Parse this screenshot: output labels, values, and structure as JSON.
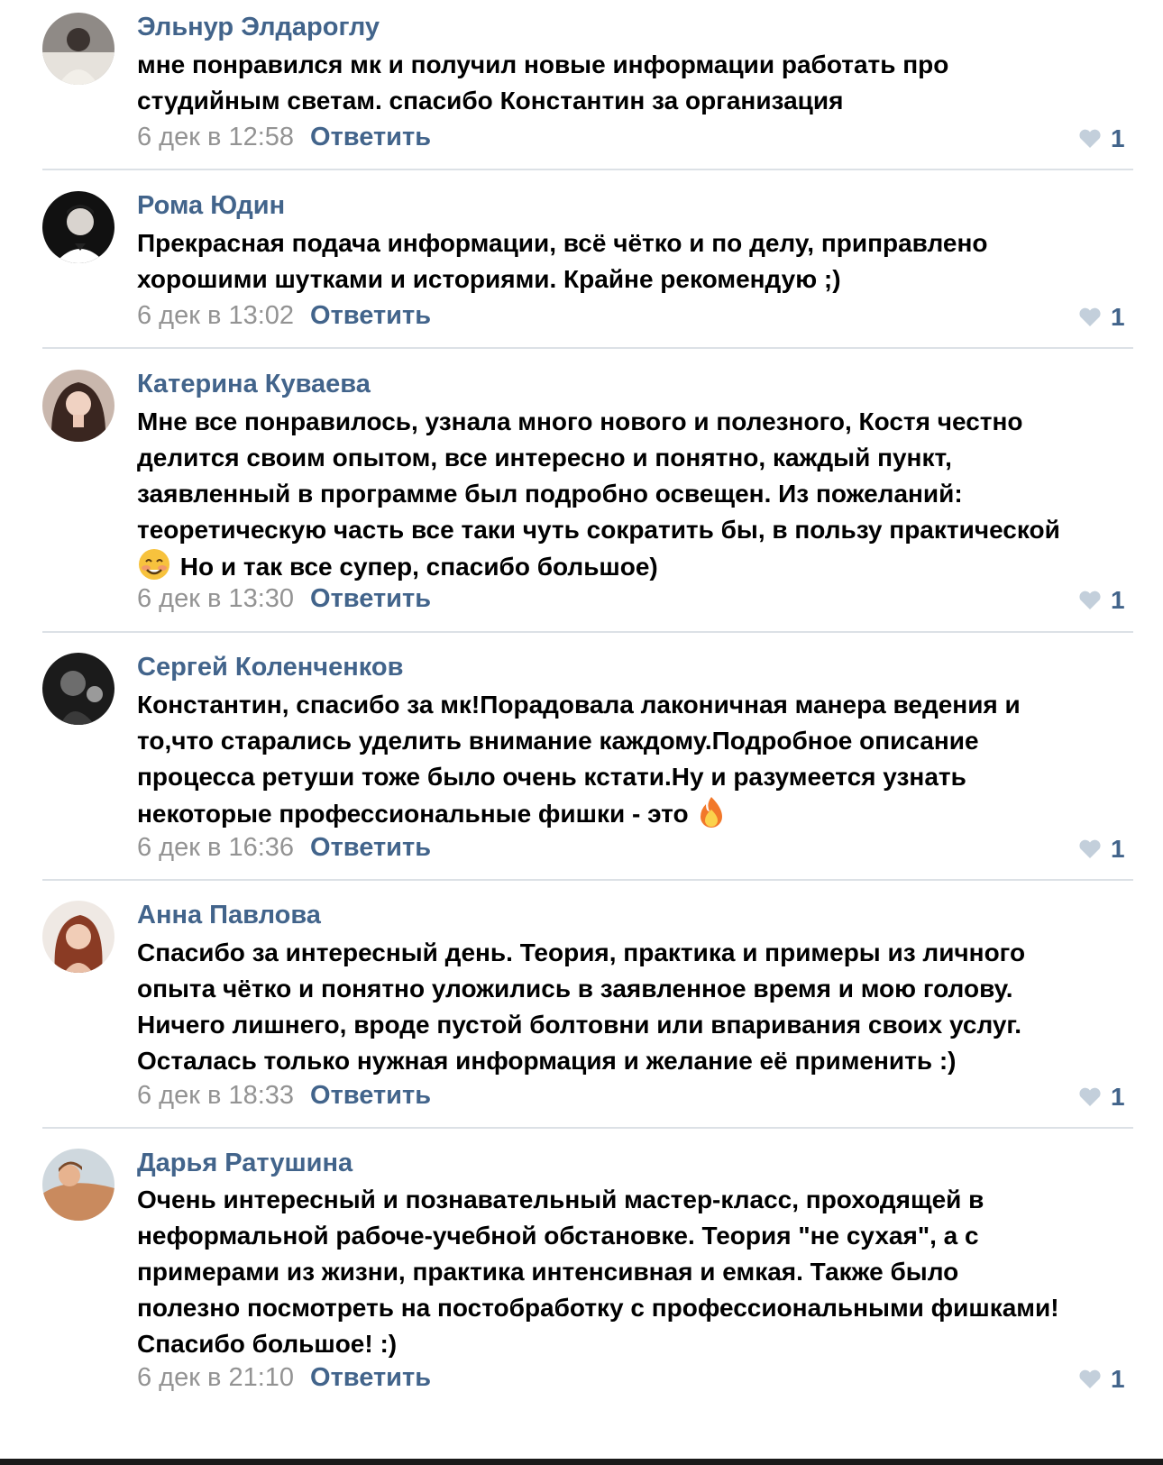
{
  "colors": {
    "author": "#42648b",
    "meta": "#939393",
    "reply": "#42648b",
    "text": "#000000",
    "divider": "#dce1e6",
    "heart": "#c3cfdb"
  },
  "comments": [
    {
      "author": "Эльнур Элдароглу",
      "lines": [
        "мне понравился мк и получил новые информации работать про",
        "студийным светам. спасибо Константин за организация"
      ],
      "date": "6 дек в 12:58",
      "reply_label": "Ответить",
      "likes": "1"
    },
    {
      "author": "Рома Юдин",
      "lines": [
        "Прекрасная подача информации, всё чётко и по делу, приправлено",
        "хорошими шутками и историями. Крайне рекомендую ;)"
      ],
      "date": "6 дек в 13:02",
      "reply_label": "Ответить",
      "likes": "1"
    },
    {
      "author": "Катерина Куваева",
      "lines": [
        "Мне все понравилось, узнала много нового и полезного, Костя честно",
        "делится своим опытом, все интересно и понятно, каждый пункт,",
        "заявленный в программе был подробно освещен. Из пожеланий:",
        "теоретическую часть все таки чуть сократить бы, в пользу практической",
        "Но и так все супер, спасибо большое)"
      ],
      "date": "6 дек в 13:30",
      "reply_label": "Ответить",
      "likes": "1"
    },
    {
      "author": "Сергей Коленченков",
      "lines": [
        "Константин, спасибо за мк!Порадовала лаконичная манера ведения и",
        "то,что старались уделить внимание каждому.Подробное описание",
        "процесса ретуши тоже было очень кстати.Ну и разумеется узнать",
        "некоторые профессиональные фишки - это"
      ],
      "date": "6 дек в 16:36",
      "reply_label": "Ответить",
      "likes": "1"
    },
    {
      "author": "Анна Павлова",
      "lines": [
        "Спасибо за интересный день. Теория, практика и примеры из личного",
        "опыта чётко и понятно уложились в заявленное время и мою голову.",
        "Ничего лишнего, вроде пустой болтовни или впаривания своих услуг.",
        "Осталась только нужная информация и желание её применить :)"
      ],
      "date": "6 дек в 18:33",
      "reply_label": "Ответить",
      "likes": "1"
    },
    {
      "author": "Дарья Ратушина",
      "lines": [
        "Очень интересный и познавательный мастер-класс, проходящей в",
        "неформальной рабоче-учебной обстановке. Теория \"не сухая\", а с",
        "примерами из жизни, практика интенсивная и емкая. Также было",
        "полезно посмотреть на постобработку с профессиональными фишками!",
        "Спасибо большое! :)"
      ],
      "date": "6 дек в 21:10",
      "reply_label": "Ответить",
      "likes": "1"
    }
  ],
  "icons": {
    "like": "heart-icon",
    "emoji_smile": "blushing-smile-emoji-icon",
    "emoji_fire": "fire-emoji-icon"
  }
}
